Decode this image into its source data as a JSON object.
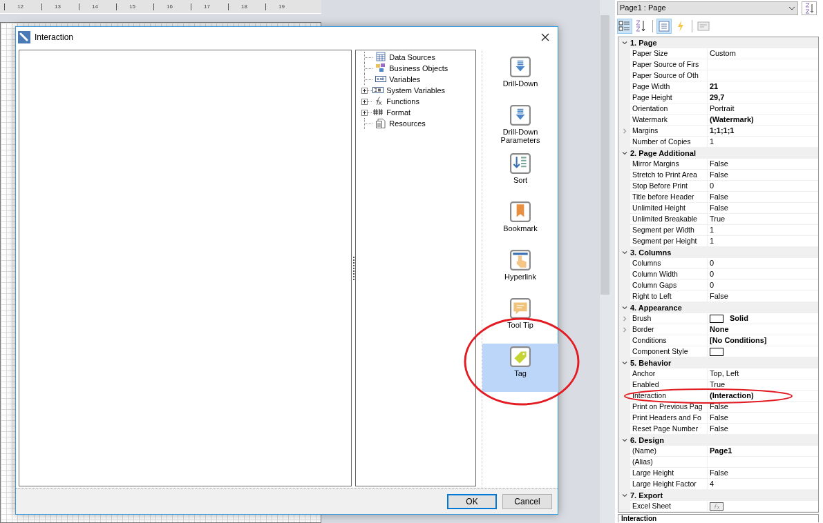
{
  "ruler": {
    "marks": [
      "12",
      "13",
      "14",
      "15",
      "16",
      "17",
      "18",
      "19"
    ]
  },
  "dialog": {
    "title": "Interaction",
    "tree": [
      {
        "label": "Data Sources",
        "kind": "table",
        "expandable": false
      },
      {
        "label": "Business Objects",
        "kind": "objects",
        "expandable": false
      },
      {
        "label": "Variables",
        "kind": "var",
        "expandable": false
      },
      {
        "label": "System Variables",
        "kind": "sysvar",
        "expandable": true
      },
      {
        "label": "Functions",
        "kind": "fx",
        "expandable": true
      },
      {
        "label": "Format",
        "kind": "format",
        "expandable": true
      },
      {
        "label": "Resources",
        "kind": "resources",
        "expandable": false
      }
    ],
    "actions": [
      {
        "label": "Drill-Down",
        "kind": "drilldown",
        "selected": false
      },
      {
        "label": "Drill-Down Parameters",
        "kind": "drilldown",
        "selected": false
      },
      {
        "label": "Sort",
        "kind": "sort",
        "selected": false
      },
      {
        "label": "Bookmark",
        "kind": "bookmark",
        "selected": false
      },
      {
        "label": "Hyperlink",
        "kind": "hyperlink",
        "selected": false
      },
      {
        "label": "Tool Tip",
        "kind": "tooltip",
        "selected": false
      },
      {
        "label": "Tag",
        "kind": "tag",
        "selected": true
      }
    ],
    "buttons": [
      "OK",
      "Cancel"
    ]
  },
  "properties": {
    "object": "Page1 : Page",
    "toolbar": [
      {
        "kind": "categorized",
        "selected": true
      },
      {
        "kind": "alphabetical",
        "selected": false
      },
      {
        "kind": "properties",
        "selected": true
      },
      {
        "kind": "events",
        "selected": false
      },
      {
        "kind": "other",
        "selected": false
      }
    ],
    "categories": [
      {
        "title": "1. Page",
        "items": [
          {
            "name": "Paper Size",
            "value": "Custom",
            "bold": false,
            "expandable": false,
            "kind": "text"
          },
          {
            "name": "Paper Source of Firs",
            "value": "",
            "expandable": false,
            "kind": "text"
          },
          {
            "name": "Paper Source of Oth",
            "value": "",
            "expandable": false,
            "kind": "text"
          },
          {
            "name": "Page Width",
            "value": "21",
            "bold": true,
            "expandable": false,
            "kind": "text"
          },
          {
            "name": "Page Height",
            "value": "29,7",
            "bold": true,
            "expandable": false,
            "kind": "text"
          },
          {
            "name": "Orientation",
            "value": "Portrait",
            "bold": false,
            "expandable": false,
            "kind": "text"
          },
          {
            "name": "Watermark",
            "value": "(Watermark)",
            "bold": true,
            "expandable": false,
            "kind": "text"
          },
          {
            "name": "Margins",
            "value": "1;1;1;1",
            "bold": true,
            "expandable": true,
            "kind": "text"
          },
          {
            "name": "Number of Copies",
            "value": "1",
            "bold": false,
            "expandable": false,
            "kind": "text"
          }
        ]
      },
      {
        "title": "2. Page  Additional",
        "items": [
          {
            "name": "Mirror Margins",
            "value": "False",
            "bold": false,
            "expandable": false,
            "kind": "text"
          },
          {
            "name": "Stretch to Print Area",
            "value": "False",
            "bold": false,
            "expandable": false,
            "kind": "text"
          },
          {
            "name": "Stop Before Print",
            "value": "0",
            "bold": false,
            "expandable": false,
            "kind": "text"
          },
          {
            "name": "Title before Header",
            "value": "False",
            "bold": false,
            "expandable": false,
            "kind": "text"
          },
          {
            "name": "Unlimited Height",
            "value": "False",
            "bold": false,
            "expandable": false,
            "kind": "text"
          },
          {
            "name": "Unlimited Breakable",
            "value": "True",
            "bold": false,
            "expandable": false,
            "kind": "text"
          },
          {
            "name": "Segment per Width",
            "value": "1",
            "bold": false,
            "expandable": false,
            "kind": "text"
          },
          {
            "name": "Segment per Height",
            "value": "1",
            "bold": false,
            "expandable": false,
            "kind": "text"
          }
        ]
      },
      {
        "title": "3. Columns",
        "items": [
          {
            "name": "Columns",
            "value": "0",
            "bold": false,
            "expandable": false,
            "kind": "text"
          },
          {
            "name": "Column Width",
            "value": "0",
            "bold": false,
            "expandable": false,
            "kind": "text"
          },
          {
            "name": "Column Gaps",
            "value": "0",
            "bold": false,
            "expandable": false,
            "kind": "text"
          },
          {
            "name": "Right to Left",
            "value": "False",
            "bold": false,
            "expandable": false,
            "kind": "text"
          }
        ]
      },
      {
        "title": "4. Appearance",
        "items": [
          {
            "name": "Brush",
            "value": "Solid",
            "bold": true,
            "expandable": true,
            "kind": "swatch"
          },
          {
            "name": "Border",
            "value": "None",
            "bold": true,
            "expandable": true,
            "kind": "text"
          },
          {
            "name": "Conditions",
            "value": "[No Conditions]",
            "bold": true,
            "expandable": false,
            "kind": "text"
          },
          {
            "name": "Component Style",
            "value": "",
            "expandable": false,
            "kind": "swatch"
          }
        ]
      },
      {
        "title": "5. Behavior",
        "items": [
          {
            "name": "Anchor",
            "value": "Top, Left",
            "bold": false,
            "expandable": false,
            "kind": "text"
          },
          {
            "name": "Enabled",
            "value": "True",
            "bold": false,
            "expandable": false,
            "kind": "text"
          },
          {
            "name": "Interaction",
            "value": "(Interaction)",
            "bold": true,
            "expandable": false,
            "kind": "text"
          },
          {
            "name": "Print on Previous Pag",
            "value": "False",
            "bold": false,
            "expandable": false,
            "kind": "text"
          },
          {
            "name": "Print Headers and Fo",
            "value": "False",
            "bold": false,
            "expandable": false,
            "kind": "text"
          },
          {
            "name": "Reset Page Number",
            "value": "False",
            "bold": false,
            "expandable": false,
            "kind": "text"
          }
        ]
      },
      {
        "title": "6. Design",
        "items": [
          {
            "name": "(Name)",
            "value": "Page1",
            "bold": true,
            "expandable": false,
            "kind": "text"
          },
          {
            "name": "(Alias)",
            "value": "",
            "expandable": false,
            "kind": "text"
          },
          {
            "name": "Large Height",
            "value": "False",
            "bold": false,
            "expandable": false,
            "kind": "text"
          },
          {
            "name": "Large Height Factor",
            "value": "4",
            "bold": false,
            "expandable": false,
            "kind": "text"
          }
        ]
      },
      {
        "title": "7. Export",
        "items": [
          {
            "name": "Excel Sheet",
            "value": "",
            "expandable": false,
            "kind": "formula"
          }
        ]
      }
    ],
    "description": "Interaction"
  }
}
